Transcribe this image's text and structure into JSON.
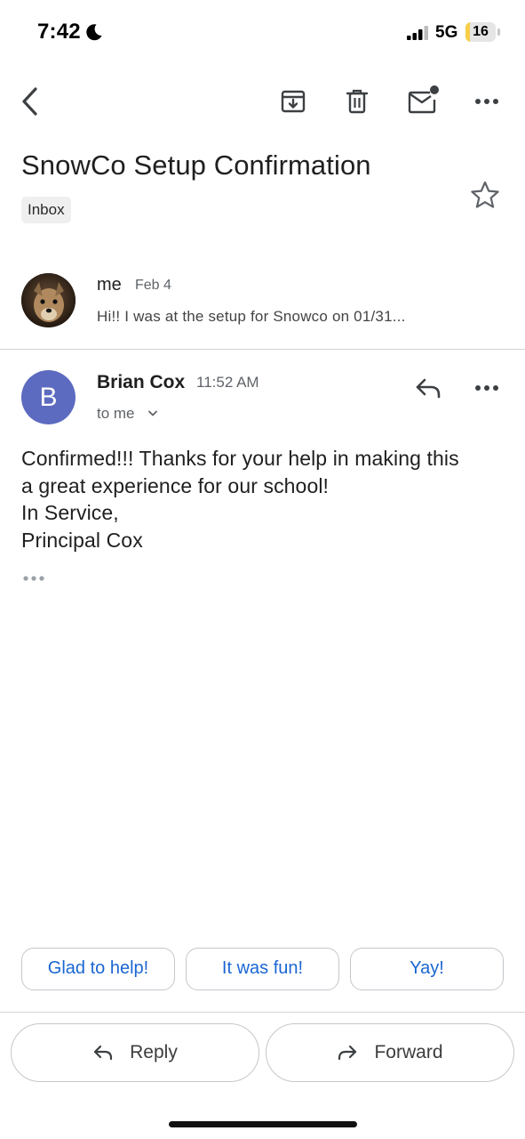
{
  "status_bar": {
    "time": "7:42",
    "network": "5G",
    "battery_level": "16",
    "battery_fraction": 0.16,
    "icons": [
      "moon-icon",
      "signal-icon",
      "battery-icon"
    ]
  },
  "toolbar": {
    "icons": [
      "back-arrow-icon",
      "archive-icon",
      "trash-icon",
      "mark-unread-icon",
      "more-horizontal-icon"
    ]
  },
  "email": {
    "subject": "SnowCo Setup Confirmation",
    "label": "Inbox",
    "starred": false
  },
  "thread": {
    "collapsed_message": {
      "sender": "me",
      "date": "Feb 4",
      "snippet": "Hi!! I was at the setup for Snowco on 01/31..."
    },
    "expanded_message": {
      "avatar_letter": "B",
      "sender": "Brian Cox",
      "time": "11:52 AM",
      "recipient": "to me",
      "body_lines": [
        "Confirmed!!! Thanks for your help in making this",
        "a great experience for our school!",
        "In Service,",
        "Principal Cox"
      ]
    }
  },
  "smart_replies": [
    "Glad to help!",
    "It was fun!",
    "Yay!"
  ],
  "actions": {
    "reply_label": "Reply",
    "forward_label": "Forward"
  },
  "colors": {
    "accent_blue": "#1a66d2",
    "avatar_color": "#5c6bc0",
    "battery_yellow": "#f7ce46"
  }
}
